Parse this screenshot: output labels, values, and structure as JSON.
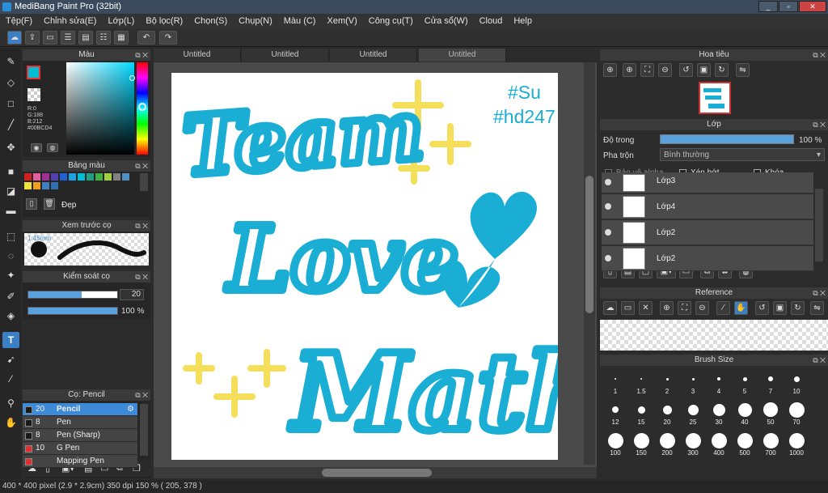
{
  "app": {
    "title": "MediBang Paint Pro (32bit)"
  },
  "menu": [
    "Tệp(F)",
    "Chỉnh sửa(E)",
    "Lớp(L)",
    "Bộ lọc(R)",
    "Chọn(S)",
    "Chụp(N)",
    "Màu (C)",
    "Xem(V)",
    "Công cụ(T)",
    "Cửa sổ(W)",
    "Cloud",
    "Help"
  ],
  "tabs": [
    "Untitled",
    "Untitled",
    "Untitled",
    "Untitled"
  ],
  "color_panel": {
    "title": "Màu",
    "r": "R:0",
    "g": "G:188",
    "b": "B:212",
    "hex": "#00BCD4",
    "accent": "#00BCD4"
  },
  "palette_panel": {
    "title": "Bảng màu",
    "preset": "Đẹp"
  },
  "brush_preview": {
    "title": "Xem trước cọ",
    "size": "1.45mm"
  },
  "brush_control": {
    "title": "Kiểm soát cọ",
    "size": "20",
    "opacity": "100 %",
    "size_fraction": 0.6,
    "opacity_fraction": 1.0
  },
  "brush_list": {
    "title": "Cọ: Pencil",
    "items": [
      {
        "num": "20",
        "name": "Pencil",
        "color": "#1a1a1a",
        "selected": true
      },
      {
        "num": "8",
        "name": "Pen",
        "color": "#1a1a1a",
        "selected": false
      },
      {
        "num": "8",
        "name": "Pen (Sharp)",
        "color": "#1a1a1a",
        "selected": false
      },
      {
        "num": "10",
        "name": "G Pen",
        "color": "#e03030",
        "selected": false
      },
      {
        "num": "",
        "name": "Mapping Pen",
        "color": "#e03030",
        "selected": false
      }
    ]
  },
  "canvas_art": {
    "line1": "Team",
    "line2": "Love",
    "line3": "Math",
    "tag1": "#Su",
    "tag2": "#hd247",
    "ink": "#1aaed4",
    "star": "#f5de5a"
  },
  "navigator": {
    "title": "Hoa tiêu"
  },
  "layer_panel": {
    "title": "Lớp",
    "opacity_label": "Độ trong",
    "opacity_value": "100 %",
    "opacity_fraction": 1.0,
    "blend_label": "Pha trộn",
    "blend_value": "Bình thường",
    "protect_alpha": "Bảo vệ alpha",
    "clipping": "Xén bớt",
    "lock": "Khóa",
    "layers": [
      "Lớp3",
      "Lớp4",
      "Lớp2",
      "Lớp2"
    ]
  },
  "reference_panel": {
    "title": "Reference"
  },
  "brush_size_panel": {
    "title": "Brush Size",
    "sizes": [
      "1",
      "1.5",
      "2",
      "3",
      "4",
      "5",
      "7",
      "10",
      "12",
      "15",
      "20",
      "25",
      "30",
      "40",
      "50",
      "70",
      "100",
      "150",
      "200",
      "300",
      "400",
      "500",
      "700",
      "1000"
    ]
  },
  "status": "400 * 400 pixel   (2.9 * 2.9cm)  350 dpi  150 %   ( 205, 378 )"
}
